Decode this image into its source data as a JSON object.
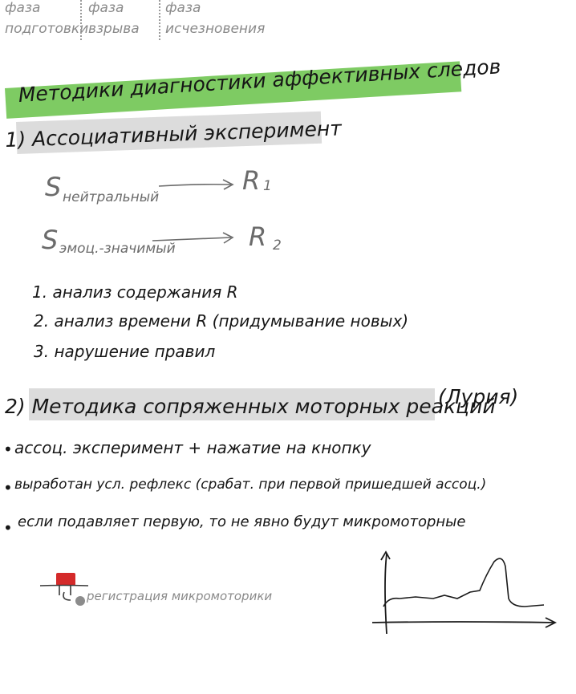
{
  "phases": [
    {
      "line1": "фаза",
      "line2": "подготовки"
    },
    {
      "line1": "фаза",
      "line2": "взрыва"
    },
    {
      "line1": "фаза",
      "line2": "исчезновения"
    }
  ],
  "title": "Методики диагностики аффективных следов",
  "section1": {
    "heading": "1) Ассоциативный эксперимент",
    "s1": "S",
    "s1_sub": "нейтральный",
    "r1": "R",
    "r1_sub": "1",
    "s2": "S",
    "s2_sub": "эмоц.-значимый",
    "r2": "R",
    "r2_sub": "2",
    "items": [
      "1. анализ содержания R",
      "2. анализ времени R (придумывание новых)",
      "3. нарушение правил"
    ]
  },
  "section2": {
    "heading": "2) Методика сопряженных моторных реакций",
    "author": "(Лурия)",
    "bullets": [
      "ассоц. эксперимент + нажатие на кнопку",
      "выработан усл. рефлекс (срабат. при первой пришедшей ассоц.)",
      "если подавляет первую, то не явно будут микромоторные"
    ],
    "device_label": "регистрация микромоторики"
  },
  "colors": {
    "highlight_green": "#7ecb63",
    "highlight_grey": "#dcdcdc",
    "device_red": "#d42a2a",
    "device_ball": "#8c8c8c"
  }
}
